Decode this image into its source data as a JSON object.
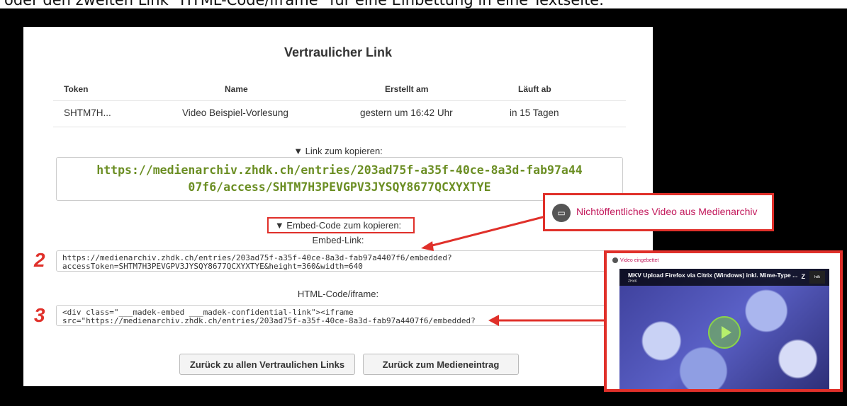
{
  "caption": "oder den zweiten Link \"HTML-Code/iframe\" für eine Einbettung in eine Textseite.",
  "title": "Vertraulicher Link",
  "table": {
    "headers": [
      "Token",
      "Name",
      "Erstellt am",
      "Läuft ab"
    ],
    "row": [
      "SHTM7H...",
      "Video Beispiel-Vorlesung",
      "gestern um 16:42 Uhr",
      "in 15 Tagen"
    ]
  },
  "link_section": {
    "toggle": "▼ Link zum kopieren:",
    "line1": "https://medienarchiv.zhdk.ch/entries/203ad75f-a35f-40ce-8a3d-fab97a44",
    "line2": "07f6/access/SHTM7H3PEVGPV3JYSQY8677QCXYXTYE"
  },
  "embed_section": {
    "toggle": "▼ Embed-Code zum kopieren:",
    "embed_label": "Embed-Link:",
    "embed_line1": "https://medienarchiv.zhdk.ch/entries/203ad75f-a35f-40ce-8a3d-fab97a4407f6/embedded?",
    "embed_line2": "accessToken=SHTM7H3PEVGPV3JYSQY8677QCXYXTYE&height=360&width=640",
    "html_label": "HTML-Code/iframe:",
    "html_line1": "<div class=\"___madek-embed ___madek-confidential-link\"><iframe",
    "html_line2": "src=\"https://medienarchiv.zhdk.ch/entries/203ad75f-a35f-40ce-8a3d-fab97a4407f6/embedded?"
  },
  "buttons": {
    "back_links": "Zurück zu allen Vertraulichen Links",
    "back_entry": "Zurück zum Medieneintrag"
  },
  "annotations": {
    "num2": "2",
    "num3": "3"
  },
  "callout": {
    "text": "Nichtöffentliches Video aus Medienarchiv",
    "icon": "video-icon"
  },
  "preview": {
    "header": "Video eingebettet",
    "video_title": "MKV Upload Firefox via Citrix (Windows) inkl. Mime-Type ...",
    "video_sub": "ZHdK",
    "z_label": "Z",
    "logo": "hdk"
  },
  "colors": {
    "accent_red": "#e0302a",
    "link_green": "#6b8e23",
    "callout_pink": "#c2185b"
  }
}
